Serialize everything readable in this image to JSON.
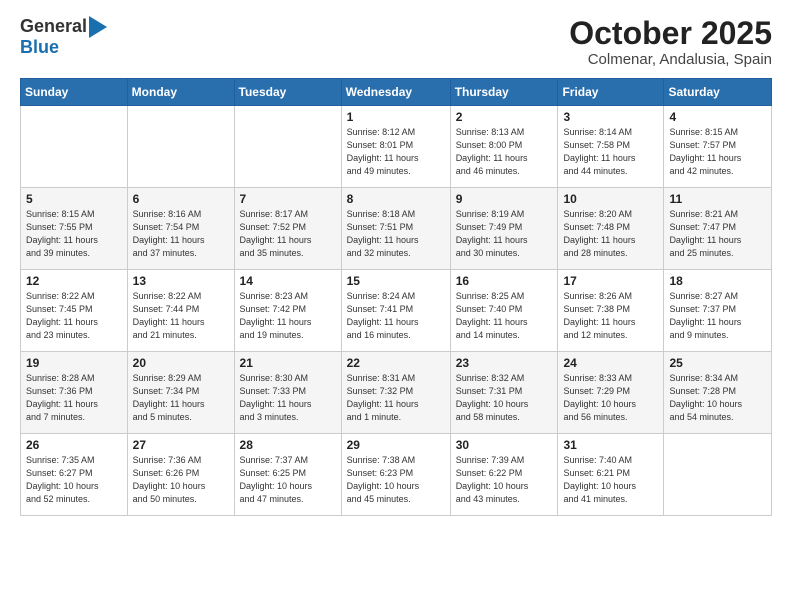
{
  "header": {
    "logo_general": "General",
    "logo_blue": "Blue",
    "month_title": "October 2025",
    "location": "Colmenar, Andalusia, Spain"
  },
  "days_of_week": [
    "Sunday",
    "Monday",
    "Tuesday",
    "Wednesday",
    "Thursday",
    "Friday",
    "Saturday"
  ],
  "weeks": [
    [
      {
        "day": "",
        "info": ""
      },
      {
        "day": "",
        "info": ""
      },
      {
        "day": "",
        "info": ""
      },
      {
        "day": "1",
        "info": "Sunrise: 8:12 AM\nSunset: 8:01 PM\nDaylight: 11 hours\nand 49 minutes."
      },
      {
        "day": "2",
        "info": "Sunrise: 8:13 AM\nSunset: 8:00 PM\nDaylight: 11 hours\nand 46 minutes."
      },
      {
        "day": "3",
        "info": "Sunrise: 8:14 AM\nSunset: 7:58 PM\nDaylight: 11 hours\nand 44 minutes."
      },
      {
        "day": "4",
        "info": "Sunrise: 8:15 AM\nSunset: 7:57 PM\nDaylight: 11 hours\nand 42 minutes."
      }
    ],
    [
      {
        "day": "5",
        "info": "Sunrise: 8:15 AM\nSunset: 7:55 PM\nDaylight: 11 hours\nand 39 minutes."
      },
      {
        "day": "6",
        "info": "Sunrise: 8:16 AM\nSunset: 7:54 PM\nDaylight: 11 hours\nand 37 minutes."
      },
      {
        "day": "7",
        "info": "Sunrise: 8:17 AM\nSunset: 7:52 PM\nDaylight: 11 hours\nand 35 minutes."
      },
      {
        "day": "8",
        "info": "Sunrise: 8:18 AM\nSunset: 7:51 PM\nDaylight: 11 hours\nand 32 minutes."
      },
      {
        "day": "9",
        "info": "Sunrise: 8:19 AM\nSunset: 7:49 PM\nDaylight: 11 hours\nand 30 minutes."
      },
      {
        "day": "10",
        "info": "Sunrise: 8:20 AM\nSunset: 7:48 PM\nDaylight: 11 hours\nand 28 minutes."
      },
      {
        "day": "11",
        "info": "Sunrise: 8:21 AM\nSunset: 7:47 PM\nDaylight: 11 hours\nand 25 minutes."
      }
    ],
    [
      {
        "day": "12",
        "info": "Sunrise: 8:22 AM\nSunset: 7:45 PM\nDaylight: 11 hours\nand 23 minutes."
      },
      {
        "day": "13",
        "info": "Sunrise: 8:22 AM\nSunset: 7:44 PM\nDaylight: 11 hours\nand 21 minutes."
      },
      {
        "day": "14",
        "info": "Sunrise: 8:23 AM\nSunset: 7:42 PM\nDaylight: 11 hours\nand 19 minutes."
      },
      {
        "day": "15",
        "info": "Sunrise: 8:24 AM\nSunset: 7:41 PM\nDaylight: 11 hours\nand 16 minutes."
      },
      {
        "day": "16",
        "info": "Sunrise: 8:25 AM\nSunset: 7:40 PM\nDaylight: 11 hours\nand 14 minutes."
      },
      {
        "day": "17",
        "info": "Sunrise: 8:26 AM\nSunset: 7:38 PM\nDaylight: 11 hours\nand 12 minutes."
      },
      {
        "day": "18",
        "info": "Sunrise: 8:27 AM\nSunset: 7:37 PM\nDaylight: 11 hours\nand 9 minutes."
      }
    ],
    [
      {
        "day": "19",
        "info": "Sunrise: 8:28 AM\nSunset: 7:36 PM\nDaylight: 11 hours\nand 7 minutes."
      },
      {
        "day": "20",
        "info": "Sunrise: 8:29 AM\nSunset: 7:34 PM\nDaylight: 11 hours\nand 5 minutes."
      },
      {
        "day": "21",
        "info": "Sunrise: 8:30 AM\nSunset: 7:33 PM\nDaylight: 11 hours\nand 3 minutes."
      },
      {
        "day": "22",
        "info": "Sunrise: 8:31 AM\nSunset: 7:32 PM\nDaylight: 11 hours\nand 1 minute."
      },
      {
        "day": "23",
        "info": "Sunrise: 8:32 AM\nSunset: 7:31 PM\nDaylight: 10 hours\nand 58 minutes."
      },
      {
        "day": "24",
        "info": "Sunrise: 8:33 AM\nSunset: 7:29 PM\nDaylight: 10 hours\nand 56 minutes."
      },
      {
        "day": "25",
        "info": "Sunrise: 8:34 AM\nSunset: 7:28 PM\nDaylight: 10 hours\nand 54 minutes."
      }
    ],
    [
      {
        "day": "26",
        "info": "Sunrise: 7:35 AM\nSunset: 6:27 PM\nDaylight: 10 hours\nand 52 minutes."
      },
      {
        "day": "27",
        "info": "Sunrise: 7:36 AM\nSunset: 6:26 PM\nDaylight: 10 hours\nand 50 minutes."
      },
      {
        "day": "28",
        "info": "Sunrise: 7:37 AM\nSunset: 6:25 PM\nDaylight: 10 hours\nand 47 minutes."
      },
      {
        "day": "29",
        "info": "Sunrise: 7:38 AM\nSunset: 6:23 PM\nDaylight: 10 hours\nand 45 minutes."
      },
      {
        "day": "30",
        "info": "Sunrise: 7:39 AM\nSunset: 6:22 PM\nDaylight: 10 hours\nand 43 minutes."
      },
      {
        "day": "31",
        "info": "Sunrise: 7:40 AM\nSunset: 6:21 PM\nDaylight: 10 hours\nand 41 minutes."
      },
      {
        "day": "",
        "info": ""
      }
    ]
  ]
}
